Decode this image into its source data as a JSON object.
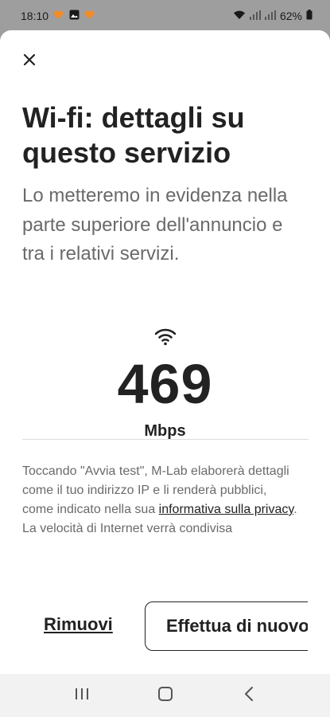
{
  "status_bar": {
    "time": "18:10",
    "battery": "62%",
    "icons": [
      "heart-notification-icon",
      "image-notification-icon",
      "heart-notification-icon",
      "wifi-icon",
      "signal-icon",
      "signal-icon",
      "battery-icon"
    ]
  },
  "sheet": {
    "close_icon": "close-icon",
    "title": "Wi-fi: dettagli su questo servizio",
    "subtitle": "Lo metteremo in evidenza nella parte superiore dell'annuncio e tra i relativi servizi.",
    "speed": {
      "icon": "wifi-icon",
      "value": "469",
      "unit": "Mbps"
    },
    "disclaimer": {
      "before_link": "Toccando \"Avvia test\", M-Lab elaborerà dettagli come il tuo indirizzo IP e li renderà pubblici, come indicato nella sua ",
      "link": "informativa sulla privacy",
      "after_link": ". La velocità di Internet verrà condivisa"
    },
    "actions": {
      "remove_label": "Rimuovi",
      "retest_label": "Effettua di nuovo"
    }
  },
  "nav_bar": {
    "icons": [
      "recent-apps-icon",
      "home-icon",
      "back-icon"
    ]
  },
  "colors": {
    "text_primary": "#222222",
    "text_secondary": "#6a6a6a",
    "status_bar_bg": "#9e9e9e",
    "notification_orange": "#f28c28"
  }
}
